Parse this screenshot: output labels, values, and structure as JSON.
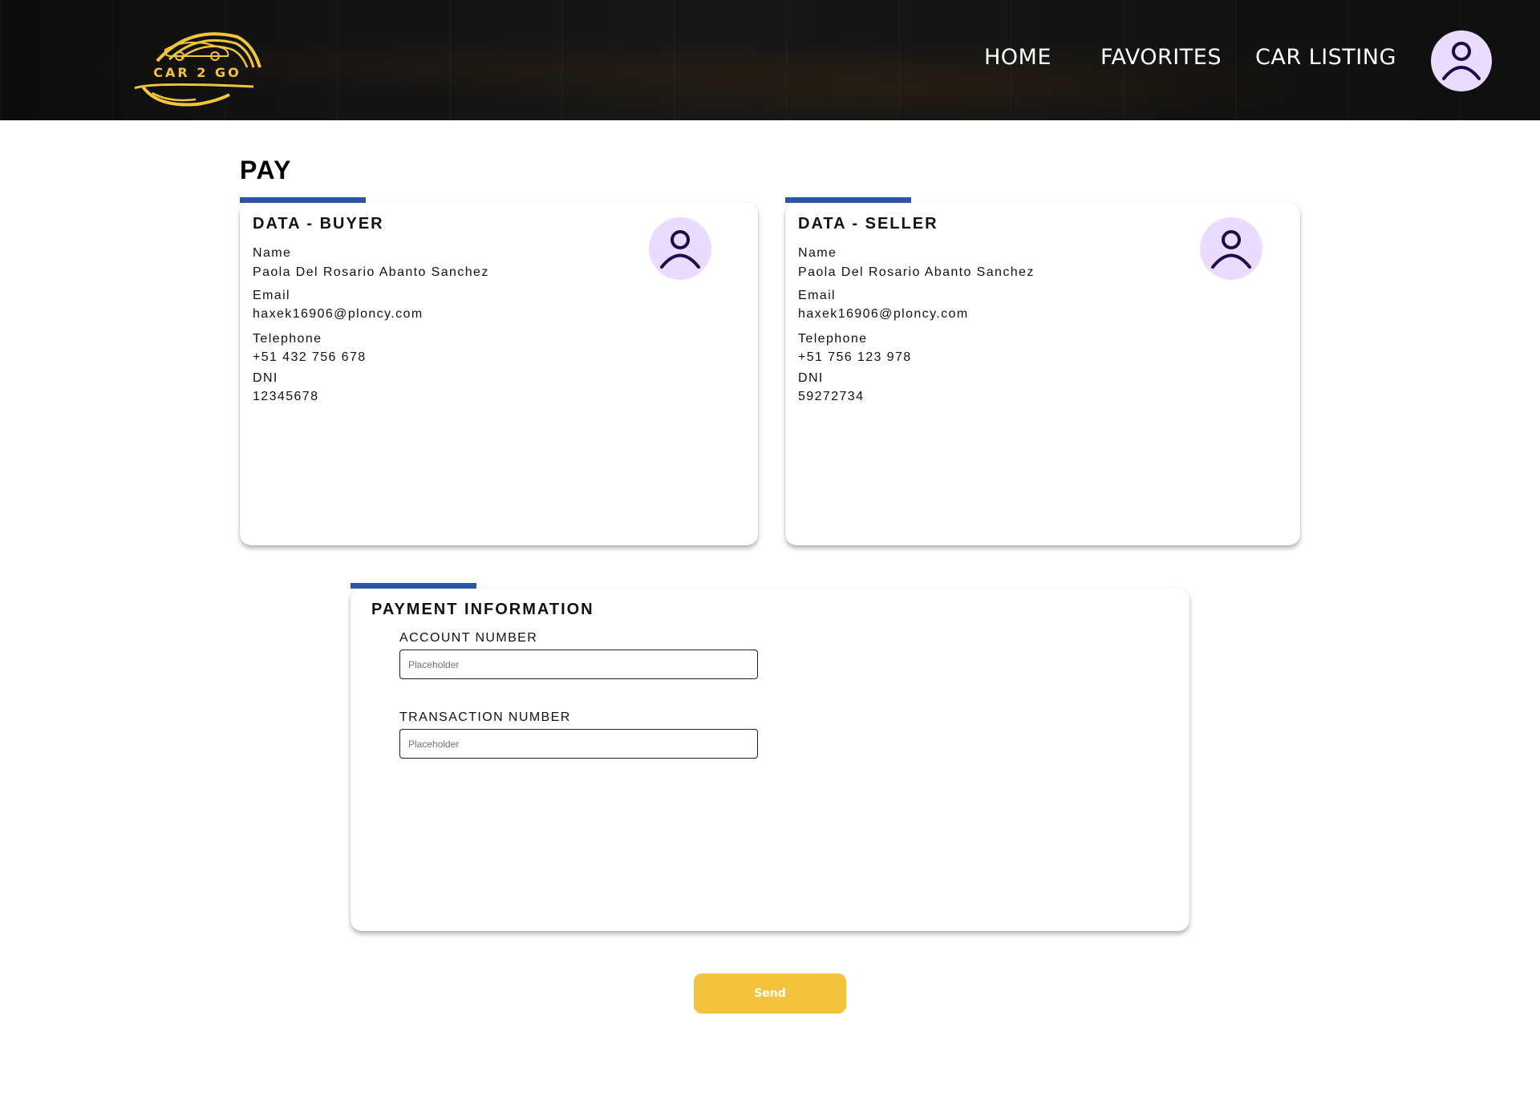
{
  "header": {
    "logo_text": "CAR 2 GO",
    "nav": {
      "home": "HOME",
      "favorites": "FAVORITES",
      "car_listing": "CAR LISTING"
    },
    "avatar_icon": "user-icon"
  },
  "page": {
    "title": "PAY"
  },
  "buyer": {
    "title": "DATA - BUYER",
    "name_label": "Name",
    "name": "Paola Del Rosario Abanto Sanchez",
    "email_label": "Email",
    "email": "haxek16906@ploncy.com",
    "telephone_label": "Telephone",
    "telephone": "+51 432 756 678",
    "dni_label": "DNI",
    "dni": "12345678",
    "avatar_icon": "user-icon"
  },
  "seller": {
    "title": "DATA - SELLER",
    "name_label": "Name",
    "name": "Paola Del Rosario Abanto Sanchez",
    "email_label": "Email",
    "email": "haxek16906@ploncy.com",
    "telephone_label": "Telephone",
    "telephone": "+51 756 123 978",
    "dni_label": "DNI",
    "dni": "59272734",
    "avatar_icon": "user-icon"
  },
  "payment": {
    "title": "PAYMENT INFORMATION",
    "account_label": "ACCOUNT NUMBER",
    "account_placeholder": "Placeholder",
    "account_value": "",
    "transaction_label": "TRANSACTION NUMBER",
    "transaction_placeholder": "Placeholder",
    "transaction_value": ""
  },
  "actions": {
    "send_label": "Send"
  },
  "colors": {
    "accent_bar": "#2c55a8",
    "send_button": "#f4c33d",
    "avatar_bg": "#eadcff",
    "avatar_icon": "#1e0a4a",
    "logo_gold": "#f2c53a"
  }
}
